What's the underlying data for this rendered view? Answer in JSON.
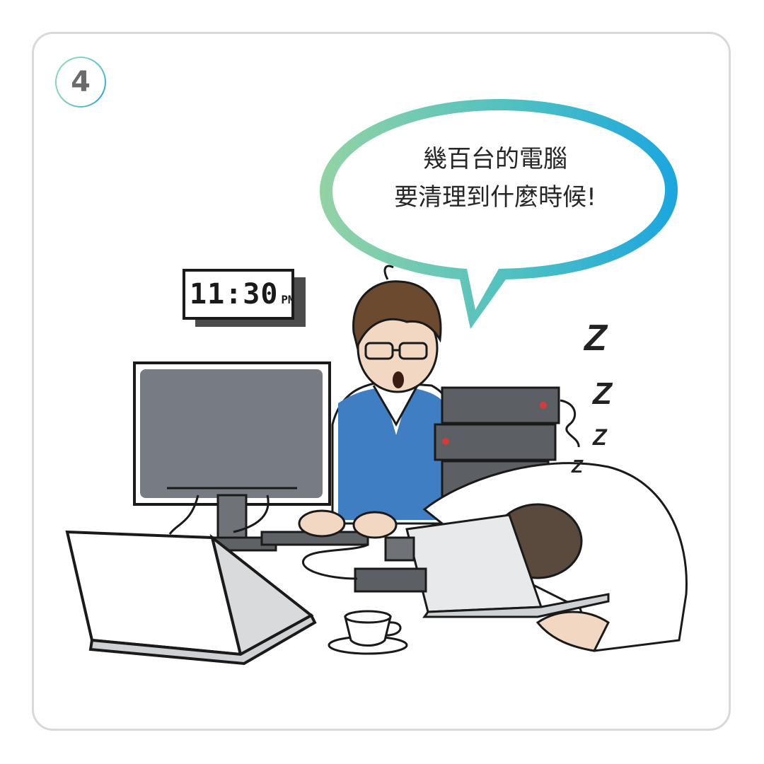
{
  "panel_number": "4",
  "speech_bubble": {
    "line1": "幾百台的電腦",
    "line2": "要清理到什麼時候!"
  },
  "clock": {
    "time": "11:30",
    "period": "PM"
  },
  "sleep_marks": [
    "Z",
    "Z",
    "Z",
    "Z"
  ],
  "colors": {
    "frame_border": "#d9d9d9",
    "bubble_gradient_start": "#8fd1a6",
    "bubble_gradient_end": "#1aa6e0",
    "monitor_screen": "#777c82",
    "vest": "#3f7ec2",
    "server": "#5c6064"
  }
}
